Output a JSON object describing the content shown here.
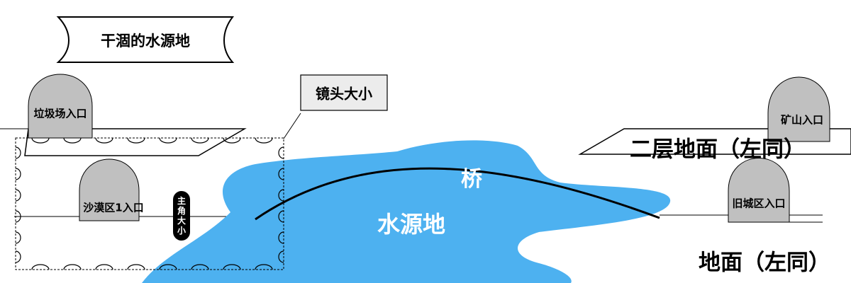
{
  "title": "干涸的水源地",
  "camera_label": "镜头大小",
  "player_label": "主角大小",
  "bridge_label": "桥",
  "water_label": "水源地",
  "upper_ground_label": "二层地面（左同）",
  "ground_label": "地面（左同）",
  "entrances": [
    {
      "id": "garbage",
      "label": "垃圾场入口"
    },
    {
      "id": "desert",
      "label": "沙漠区1入口"
    },
    {
      "id": "mine",
      "label": "矿山入口"
    },
    {
      "id": "oldtown",
      "label": "旧城区入口"
    }
  ],
  "colors": {
    "water": "#4db1f0",
    "entrance_fill": "#c0c0c0",
    "camera_box_fill": "#ececec",
    "player_fill": "#000000"
  }
}
